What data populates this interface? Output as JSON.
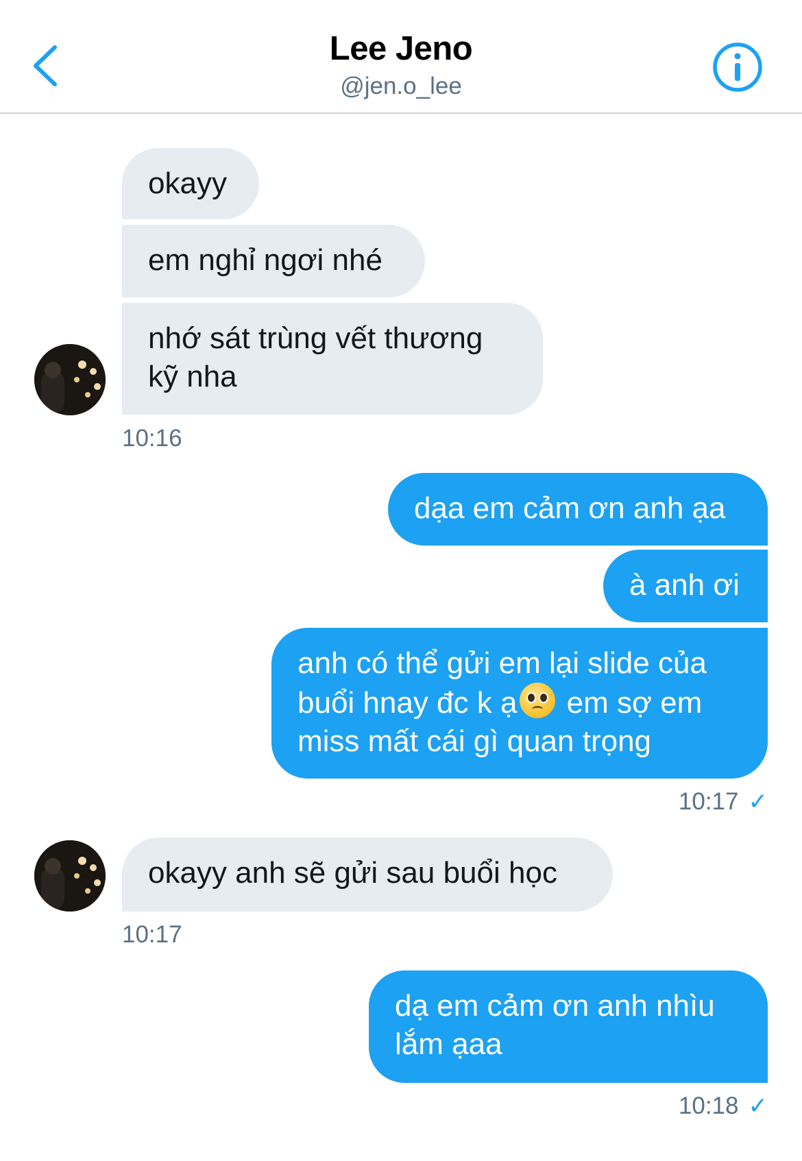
{
  "header": {
    "title": "Lee Jeno",
    "handle": "@jen.o_lee"
  },
  "messages": [
    {
      "side": "in",
      "text": "okayy"
    },
    {
      "side": "in",
      "text": "em nghỉ ngơi nhé"
    },
    {
      "side": "in",
      "line1": "nhớ sát trùng vết thương",
      "line2": "kỹ nha"
    },
    {
      "side": "out",
      "text": "dạa em cảm ơn anh ạa"
    },
    {
      "side": "out",
      "text": "à anh ơi"
    },
    {
      "side": "out",
      "line1": "anh có thể gửi em lại slide của",
      "line2_a": "buổi hnay đc k ạ",
      "line2_emoji": "pleading-face-emoji",
      "line2_b": " em sợ em",
      "line3": "miss mất cái gì quan trọng"
    },
    {
      "side": "in",
      "text": "okayy anh sẽ gửi sau buổi học"
    },
    {
      "side": "out",
      "line1": "dạ em cảm ơn anh nhìu",
      "line2": "lắm ạaa"
    }
  ],
  "timestamps": {
    "group1": "10:16",
    "group2": "10:17",
    "group3": "10:17",
    "group4": "10:18"
  },
  "status": {
    "sent_check": "✓"
  },
  "colors": {
    "accent": "#1da1f2",
    "incoming_bubble": "#e6ecf0",
    "secondary_text": "#5b7083"
  },
  "icons": {
    "back": "chevron-left-icon",
    "info": "info-circle-icon"
  }
}
